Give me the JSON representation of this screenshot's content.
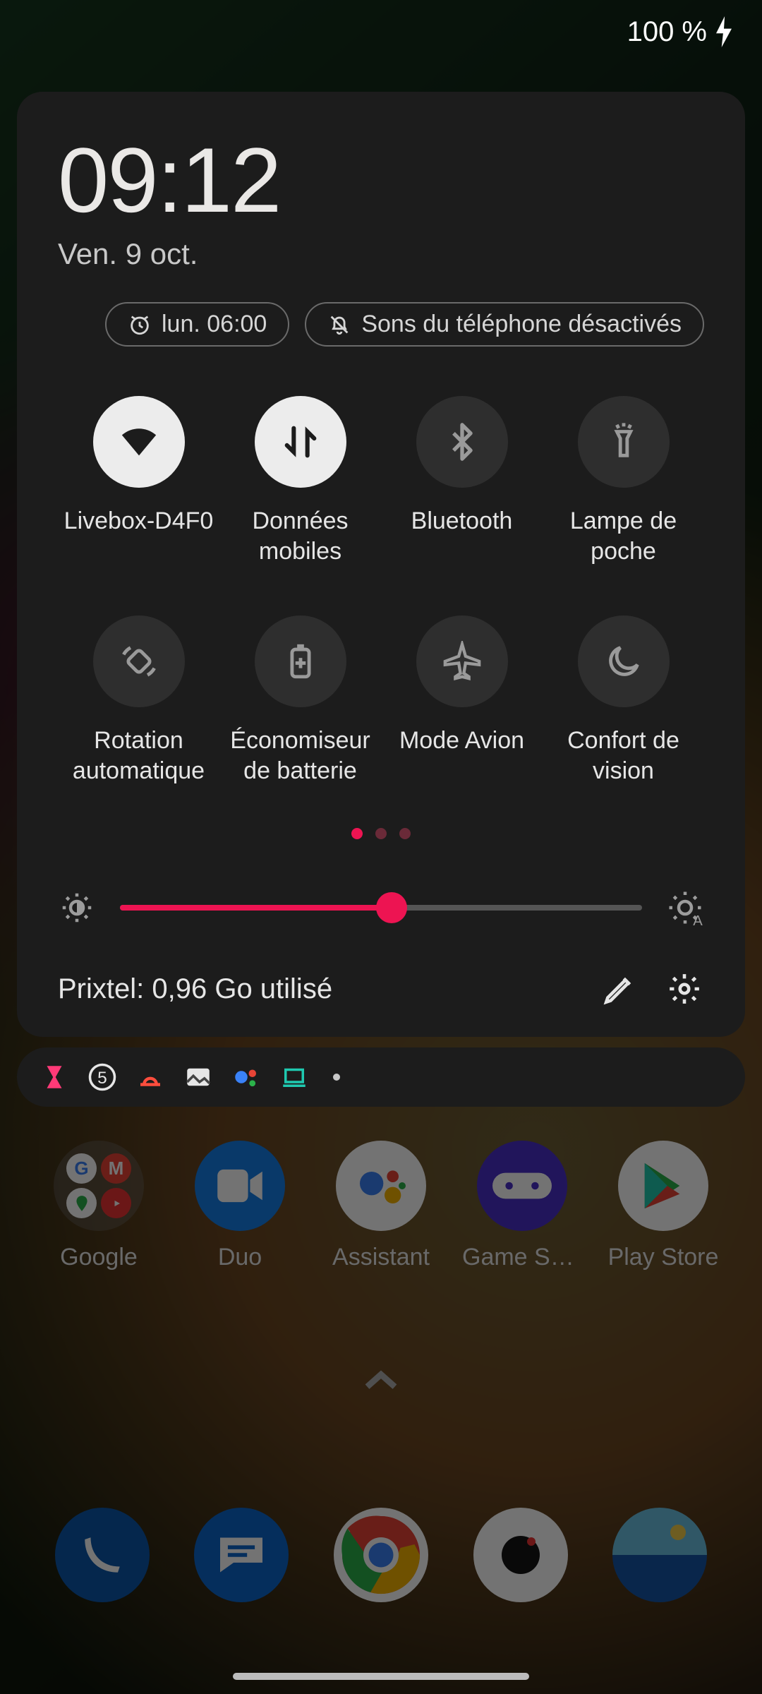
{
  "status": {
    "battery": "100 %"
  },
  "qs": {
    "time": "09:12",
    "date": "Ven. 9 oct.",
    "alarm_pill": "lun. 06:00",
    "sound_pill": "Sons du téléphone désactivés",
    "tiles": [
      {
        "label": "Livebox-D4F0",
        "active": true
      },
      {
        "label": "Données mobiles",
        "active": true
      },
      {
        "label": "Bluetooth",
        "active": false
      },
      {
        "label": "Lampe de poche",
        "active": false
      },
      {
        "label": "Rotation automatique",
        "active": false
      },
      {
        "label": "Économiseur de batterie",
        "active": false
      },
      {
        "label": "Mode Avion",
        "active": false
      },
      {
        "label": "Confort de vision",
        "active": false
      }
    ],
    "pager": {
      "count": 3,
      "active": 0
    },
    "brightness_percent": 52,
    "carrier": "Prixtel: 0,96 Go utilisé"
  },
  "apps_row": [
    {
      "label": "Google"
    },
    {
      "label": "Duo"
    },
    {
      "label": "Assistant"
    },
    {
      "label": "Game Spa..."
    },
    {
      "label": "Play Store"
    }
  ],
  "dock": [
    {
      "name": "phone"
    },
    {
      "name": "messages"
    },
    {
      "name": "chrome"
    },
    {
      "name": "camera"
    },
    {
      "name": "photos"
    }
  ]
}
